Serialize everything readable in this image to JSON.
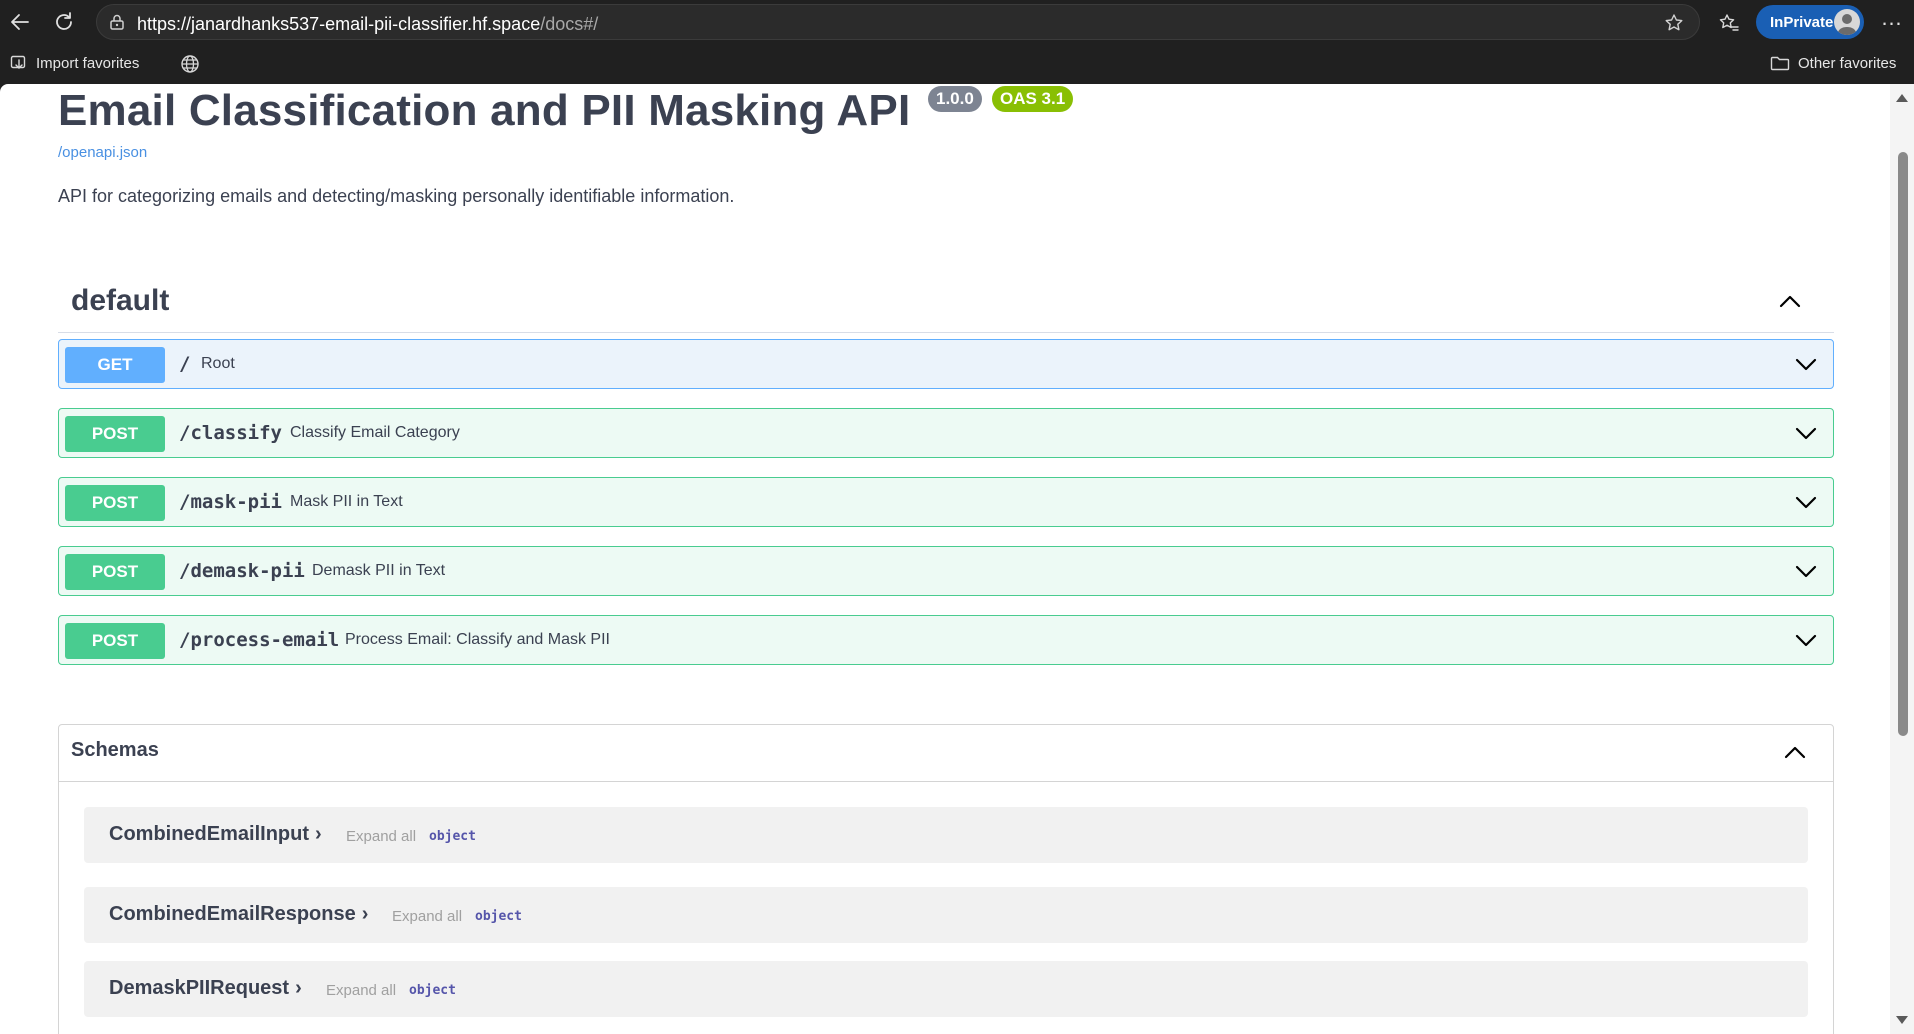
{
  "browser": {
    "url_main": "https://janardhanks537-email-pii-classifier.hf.space",
    "url_path": "/docs#/",
    "inprivate_label": "InPrivate",
    "more_label": "…",
    "bookmarks": {
      "import_label": "Import favorites",
      "other_label": "Other favorites"
    }
  },
  "page": {
    "title": "Email Classification and PII Masking API",
    "version_badge": "1.0.0",
    "oas_badge": "OAS 3.1",
    "spec_link": "/openapi.json",
    "description": "API for categorizing emails and detecting/masking personally identifiable information."
  },
  "tag": {
    "name": "default",
    "operations": [
      {
        "method": "GET",
        "path": "/",
        "summary": "Root"
      },
      {
        "method": "POST",
        "path": "/classify",
        "summary": "Classify Email Category"
      },
      {
        "method": "POST",
        "path": "/mask-pii",
        "summary": "Mask PII in Text"
      },
      {
        "method": "POST",
        "path": "/demask-pii",
        "summary": "Demask PII in Text"
      },
      {
        "method": "POST",
        "path": "/process-email",
        "summary": "Process Email: Classify and Mask PII"
      }
    ]
  },
  "schemas": {
    "title": "Schemas",
    "models": [
      {
        "name": "CombinedEmailInput",
        "expand": "Expand all",
        "type": "object",
        "toggle": "›"
      },
      {
        "name": "CombinedEmailResponse",
        "expand": "Expand all",
        "type": "object",
        "toggle": "›"
      },
      {
        "name": "DemaskPIIRequest",
        "expand": "Expand all",
        "type": "object",
        "toggle": "›"
      }
    ]
  },
  "colors": {
    "get": "#61affe",
    "post": "#49cc90",
    "inprivate": "#1a5fb4",
    "link": "#4990e2"
  }
}
